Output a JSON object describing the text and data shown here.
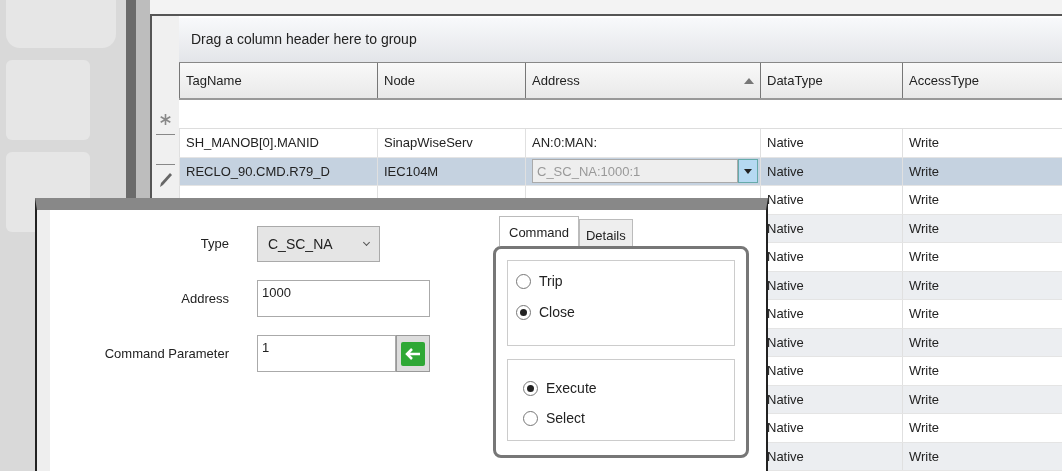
{
  "grid": {
    "group_panel": "Drag a column header here to group",
    "columns": [
      {
        "label": "TagName",
        "sorted": false
      },
      {
        "label": "Node",
        "sorted": false
      },
      {
        "label": "Address",
        "sorted": true
      },
      {
        "label": "DataType",
        "sorted": false
      },
      {
        "label": "AccessType",
        "sorted": false
      }
    ],
    "rows": [
      {
        "cells": [
          "SH_MANOB[0].MANID",
          "SinapWiseServ",
          "AN:0:MAN:",
          "Native",
          "Write"
        ],
        "selected": false,
        "editing": false
      },
      {
        "cells": [
          "RECLO_90.CMD.R79_D",
          "IEC104M",
          "C_SC_NA:1000:1",
          "Native",
          "Write"
        ],
        "selected": true,
        "editing": true
      },
      {
        "cells": [
          "",
          "",
          "",
          "Native",
          "Write"
        ],
        "selected": false
      },
      {
        "cells": [
          "",
          "",
          "",
          "Native",
          "Write"
        ],
        "selected": false
      },
      {
        "cells": [
          "",
          "",
          "",
          "Native",
          "Write"
        ],
        "selected": false
      },
      {
        "cells": [
          "",
          "",
          "",
          "Native",
          "Write"
        ],
        "selected": false
      },
      {
        "cells": [
          "",
          "",
          "",
          "Native",
          "Write"
        ],
        "selected": false
      },
      {
        "cells": [
          "",
          "",
          "",
          "Native",
          "Write"
        ],
        "selected": false
      },
      {
        "cells": [
          "",
          "",
          "",
          "Native",
          "Write"
        ],
        "selected": false
      },
      {
        "cells": [
          "",
          "",
          "",
          "Native",
          "Write"
        ],
        "selected": false
      },
      {
        "cells": [
          "",
          "",
          "",
          "Native",
          "Write"
        ],
        "selected": false
      },
      {
        "cells": [
          "",
          "",
          "",
          "Native",
          "Write"
        ],
        "selected": false
      }
    ]
  },
  "editor": {
    "fields": [
      {
        "kind": "combo",
        "label": "Type",
        "value": "C_SC_NA"
      },
      {
        "kind": "text",
        "label": "Address",
        "value": "1000"
      },
      {
        "kind": "apply",
        "label": "Command Parameter",
        "value": "1"
      }
    ],
    "tabs": [
      {
        "label": "Command",
        "selected": true
      },
      {
        "label": "Details",
        "selected": false
      }
    ],
    "groups": [
      [
        {
          "label": "Trip",
          "selected": false
        },
        {
          "label": "Close",
          "selected": true
        }
      ],
      [
        {
          "label": "Execute",
          "selected": true
        },
        {
          "label": "Select",
          "selected": false
        }
      ]
    ]
  }
}
